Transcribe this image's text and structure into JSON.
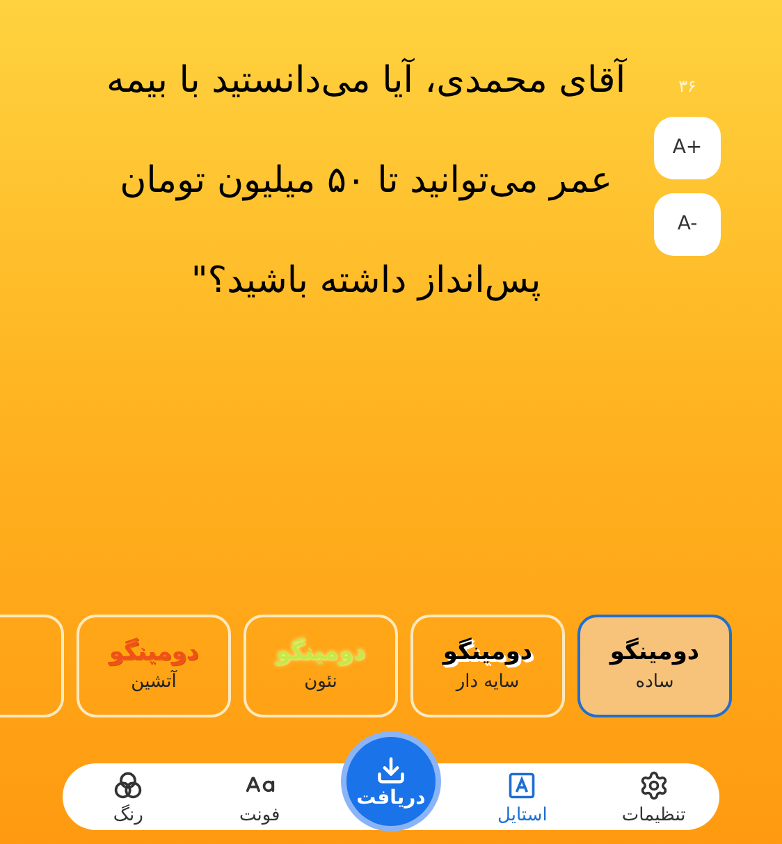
{
  "message": {
    "lines": [
      "آقای محمدی، آیا می‌دانستید با بیمه",
      "عمر می‌توانید تا ۵۰ میلیون تومان",
      "پس‌انداز داشته باشید؟\""
    ]
  },
  "size_controls": {
    "count": "۳۶",
    "buttons": [
      {
        "label": "A+"
      },
      {
        "label": "A-"
      }
    ]
  },
  "styles": [
    {
      "kind": "plain",
      "preview": "دومینگو",
      "name": "ساده",
      "selected": true
    },
    {
      "kind": "shadow",
      "preview": "دومینگو",
      "name": "سایه دار",
      "selected": false
    },
    {
      "kind": "neon",
      "preview": "دومینگو",
      "name": "نئون",
      "selected": false
    },
    {
      "kind": "fire",
      "preview": "دومینگو",
      "name": "آتشین",
      "selected": false
    },
    {
      "kind": "cut",
      "selected": false
    }
  ],
  "nav": [
    {
      "kind": "settings",
      "label": "تنظیمات",
      "selected": false
    },
    {
      "kind": "style",
      "label": "استایل",
      "selected": true
    },
    {
      "kind": "download",
      "label": "دریافت",
      "selected": false
    },
    {
      "kind": "font",
      "label": "فونت",
      "selected": false
    },
    {
      "kind": "color",
      "label": "رنگ",
      "selected": false
    }
  ]
}
